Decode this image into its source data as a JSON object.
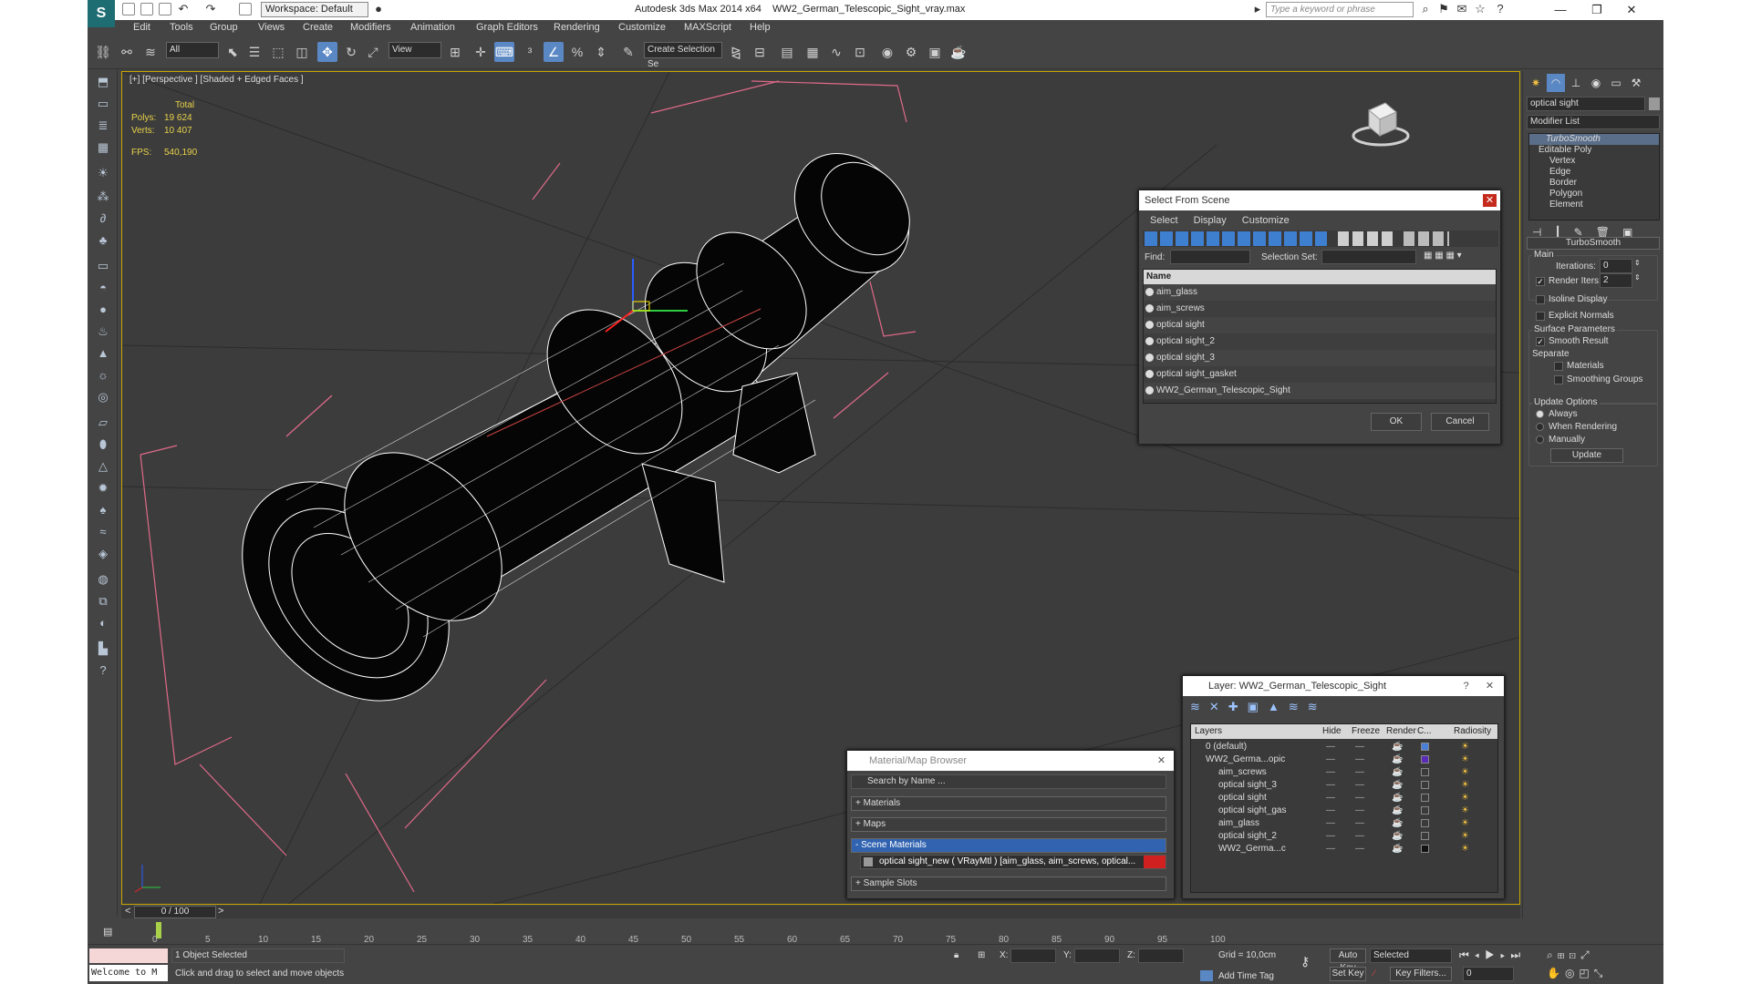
{
  "title": {
    "workspace": "Workspace: Default",
    "app": "Autodesk 3ds Max  2014 x64",
    "file": "WW2_German_Telescopic_Sight_vray.max",
    "search_placeholder": "Type a keyword or phrase"
  },
  "menu": [
    "Edit",
    "Tools",
    "Group",
    "Views",
    "Create",
    "Modifiers",
    "Animation",
    "Graph Editors",
    "Rendering",
    "Customize",
    "MAXScript",
    "Help"
  ],
  "toolbar": {
    "filter_select": "All",
    "view_select": "View",
    "selection_set": "Create Selection Se"
  },
  "viewport": {
    "label": "[+] [Perspective ] [Shaded + Edged Faces ]",
    "stats": {
      "total": "Total",
      "polys_label": "Polys:",
      "polys": "19 624",
      "verts_label": "Verts:",
      "verts": "10 407",
      "fps_label": "FPS:",
      "fps": "540,190"
    }
  },
  "select_dialog": {
    "title": "Select From Scene",
    "menu": [
      "Select",
      "Display",
      "Customize"
    ],
    "find_label": "Find:",
    "selection_set_label": "Selection Set:",
    "col_name": "Name",
    "items": [
      "aim_glass",
      "aim_screws",
      "optical sight",
      "optical sight_2",
      "optical sight_3",
      "optical sight_gasket",
      "WW2_German_Telescopic_Sight"
    ],
    "ok": "OK",
    "cancel": "Cancel"
  },
  "layer_dialog": {
    "title": "Layer: WW2_German_Telescopic_Sight",
    "cols": [
      "Layers",
      "Hide",
      "Freeze",
      "Render",
      "C...",
      "Radiosity"
    ],
    "rows": [
      {
        "name": "0 (default)",
        "color": "#4a7fd8"
      },
      {
        "name": "WW2_Germa...opic",
        "color": "#5a2ab8"
      },
      {
        "name": "aim_screws",
        "color": ""
      },
      {
        "name": "optical sight_3",
        "color": ""
      },
      {
        "name": "optical sight",
        "color": ""
      },
      {
        "name": "optical sight_gas",
        "color": ""
      },
      {
        "name": "aim_glass",
        "color": ""
      },
      {
        "name": "optical sight_2",
        "color": ""
      },
      {
        "name": "WW2_Germa...c",
        "color": "#111111"
      }
    ]
  },
  "material_browser": {
    "title": "Material/Map Browser",
    "search": "Search by Name ...",
    "sections": {
      "materials": "+ Materials",
      "maps": "+ Maps",
      "scene": "- Scene Materials",
      "sample": "+ Sample Slots"
    },
    "material_item": "optical sight_new ( VRayMtl ) [aim_glass, aim_screws, optical..."
  },
  "command_panel": {
    "object_name": "optical sight",
    "modifier_list": "Modifier List",
    "stack": [
      "TurboSmooth",
      "Editable Poly",
      "Vertex",
      "Edge",
      "Border",
      "Polygon",
      "Element"
    ],
    "rollout": "TurboSmooth",
    "main": "Main",
    "iterations_label": "Iterations:",
    "iterations": "0",
    "render_iters_label": "Render Iters:",
    "render_iters": "2",
    "isoline": "Isoline Display",
    "explicit": "Explicit Normals",
    "surface_params": "Surface Parameters",
    "smooth_result": "Smooth Result",
    "separate": "Separate",
    "materials": "Materials",
    "smoothing_groups": "Smoothing Groups",
    "update_options": "Update Options",
    "always": "Always",
    "when_rendering": "When Rendering",
    "manually": "Manually",
    "update": "Update"
  },
  "timeline": {
    "frame": "0 / 100",
    "ticks": [
      "0",
      "5",
      "10",
      "15",
      "20",
      "25",
      "30",
      "35",
      "40",
      "45",
      "50",
      "55",
      "60",
      "65",
      "70",
      "75",
      "80",
      "85",
      "90",
      "95",
      "100"
    ]
  },
  "status": {
    "maxscript": "Welcome to M",
    "selected": "1 Object Selected",
    "prompt": "Click and drag to select and move objects",
    "x_label": "X:",
    "y_label": "Y:",
    "z_label": "Z:",
    "grid": "Grid = 10,0cm",
    "add_time_tag": "Add Time Tag",
    "auto_key": "Auto Key",
    "set_key": "Set Key",
    "selected_dd": "Selected",
    "key_filters": "Key Filters...",
    "frame_field": "0"
  }
}
